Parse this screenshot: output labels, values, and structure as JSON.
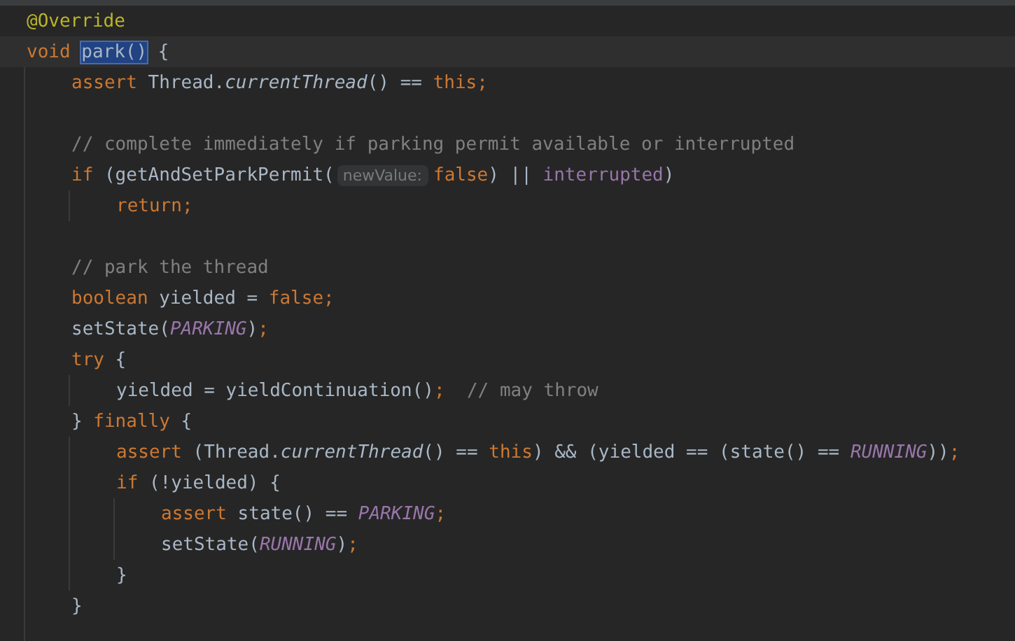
{
  "editor": {
    "lines": [
      {
        "kind": "code",
        "tokens": [
          {
            "text": "@Override",
            "kind": "annotation"
          }
        ]
      },
      {
        "kind": "code",
        "current": true,
        "tokens": [
          {
            "text": "void ",
            "kind": "keyword"
          },
          {
            "text": "park()",
            "kind": "plain",
            "selected": true
          },
          {
            "text": " {",
            "kind": "plain"
          }
        ],
        "children": [
          {
            "kind": "code",
            "tokens": [
              {
                "text": "assert",
                "kind": "keyword"
              },
              {
                "text": " Thread.",
                "kind": "plain"
              },
              {
                "text": "currentThread",
                "kind": "static"
              },
              {
                "text": "() == ",
                "kind": "plain"
              },
              {
                "text": "this;",
                "kind": "keyword"
              }
            ]
          },
          {
            "kind": "blank"
          },
          {
            "kind": "code",
            "tokens": [
              {
                "text": "// complete immediately if parking permit available or interrupted",
                "kind": "comment"
              }
            ]
          },
          {
            "kind": "code",
            "tokens": [
              {
                "text": "if",
                "kind": "keyword"
              },
              {
                "text": " (getAndSetParkPermit(",
                "kind": "plain"
              },
              {
                "text": "newValue:",
                "kind": "hint"
              },
              {
                "text": "false",
                "kind": "keyword"
              },
              {
                "text": ") || ",
                "kind": "plain"
              },
              {
                "text": "interrupted",
                "kind": "field"
              },
              {
                "text": ")",
                "kind": "plain"
              }
            ],
            "children": [
              {
                "kind": "code",
                "tokens": [
                  {
                    "text": "return;",
                    "kind": "keyword"
                  }
                ]
              }
            ]
          },
          {
            "kind": "blank"
          },
          {
            "kind": "code",
            "tokens": [
              {
                "text": "// park the thread",
                "kind": "comment"
              }
            ]
          },
          {
            "kind": "code",
            "tokens": [
              {
                "text": "boolean",
                "kind": "keyword"
              },
              {
                "text": " yielded = ",
                "kind": "plain"
              },
              {
                "text": "false;",
                "kind": "keyword"
              }
            ]
          },
          {
            "kind": "code",
            "tokens": [
              {
                "text": "setState(",
                "kind": "plain"
              },
              {
                "text": "PARKING",
                "kind": "constant"
              },
              {
                "text": ")",
                "kind": "plain"
              },
              {
                "text": ";",
                "kind": "keyword"
              }
            ]
          },
          {
            "kind": "code",
            "tokens": [
              {
                "text": "try",
                "kind": "keyword"
              },
              {
                "text": " {",
                "kind": "plain"
              }
            ],
            "children": [
              {
                "kind": "code",
                "tokens": [
                  {
                    "text": "yielded = yieldContinuation()",
                    "kind": "plain"
                  },
                  {
                    "text": ";",
                    "kind": "keyword"
                  },
                  {
                    "text": "  // may throw",
                    "kind": "comment"
                  }
                ]
              }
            ]
          },
          {
            "kind": "code",
            "tokens": [
              {
                "text": "} ",
                "kind": "plain"
              },
              {
                "text": "finally",
                "kind": "keyword"
              },
              {
                "text": " {",
                "kind": "plain"
              }
            ],
            "children": [
              {
                "kind": "code",
                "tokens": [
                  {
                    "text": "assert",
                    "kind": "keyword"
                  },
                  {
                    "text": " (Thread.",
                    "kind": "plain"
                  },
                  {
                    "text": "currentThread",
                    "kind": "static"
                  },
                  {
                    "text": "() == ",
                    "kind": "plain"
                  },
                  {
                    "text": "this",
                    "kind": "keyword"
                  },
                  {
                    "text": ") && (yielded == (state() == ",
                    "kind": "plain"
                  },
                  {
                    "text": "RUNNING",
                    "kind": "constant"
                  },
                  {
                    "text": "))",
                    "kind": "plain"
                  },
                  {
                    "text": ";",
                    "kind": "keyword"
                  }
                ]
              },
              {
                "kind": "code",
                "tokens": [
                  {
                    "text": "if",
                    "kind": "keyword"
                  },
                  {
                    "text": " (!yielded) {",
                    "kind": "plain"
                  }
                ],
                "children": [
                  {
                    "kind": "code",
                    "tokens": [
                      {
                        "text": "assert",
                        "kind": "keyword"
                      },
                      {
                        "text": " state() == ",
                        "kind": "plain"
                      },
                      {
                        "text": "PARKING",
                        "kind": "constant"
                      },
                      {
                        "text": ";",
                        "kind": "keyword"
                      }
                    ]
                  },
                  {
                    "kind": "code",
                    "tokens": [
                      {
                        "text": "setState(",
                        "kind": "plain"
                      },
                      {
                        "text": "RUNNING",
                        "kind": "constant"
                      },
                      {
                        "text": ")",
                        "kind": "plain"
                      },
                      {
                        "text": ";",
                        "kind": "keyword"
                      }
                    ]
                  }
                ]
              },
              {
                "kind": "code",
                "tokens": [
                  {
                    "text": "}",
                    "kind": "plain"
                  }
                ]
              }
            ]
          },
          {
            "kind": "code",
            "tokens": [
              {
                "text": "}",
                "kind": "plain"
              }
            ]
          }
        ]
      }
    ]
  }
}
